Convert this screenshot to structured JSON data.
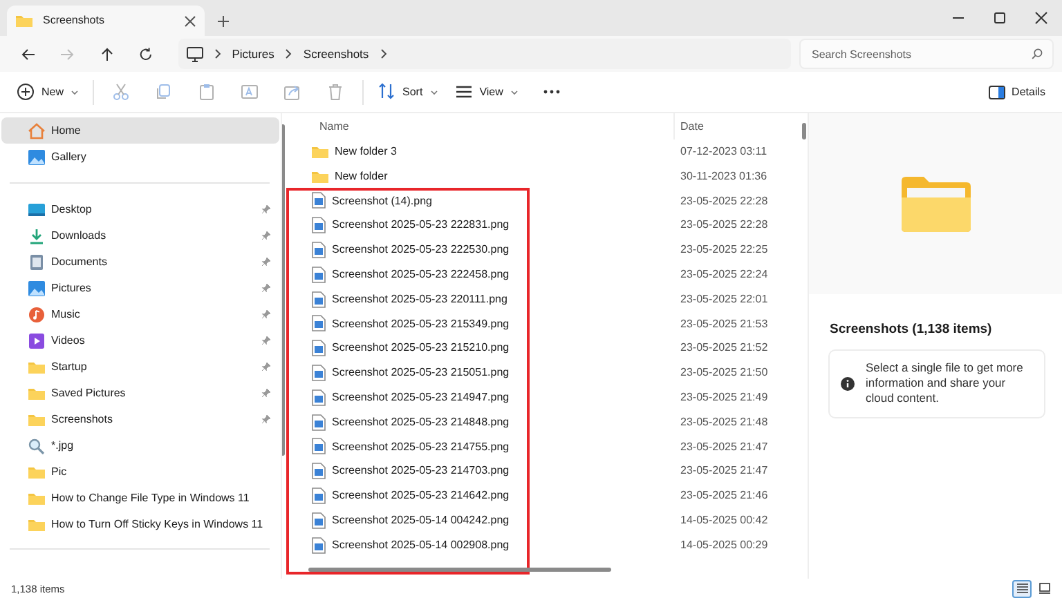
{
  "window": {
    "tab": {
      "title": "Screenshots"
    }
  },
  "navigation": {
    "breadcrumbs": [
      "Pictures",
      "Screenshots"
    ],
    "search": {
      "placeholder": "Search Screenshots"
    }
  },
  "toolbar": {
    "items": [
      {
        "kind": "menu",
        "label": "New",
        "disabled": false
      },
      {
        "kind": "icon",
        "disabled": true
      },
      {
        "kind": "icon",
        "disabled": true
      },
      {
        "kind": "icon",
        "disabled": true
      },
      {
        "kind": "icon",
        "disabled": true
      },
      {
        "kind": "icon",
        "disabled": true
      },
      {
        "kind": "icon",
        "disabled": true
      },
      {
        "kind": "menu",
        "label": "Sort",
        "disabled": false
      },
      {
        "kind": "menu",
        "label": "View",
        "disabled": false
      },
      {
        "kind": "more",
        "disabled": false
      }
    ],
    "details_button": {
      "label": "Details"
    }
  },
  "sidebar": {
    "sections": [
      [
        {
          "label": "Home",
          "pinned": false,
          "selected": true
        },
        {
          "label": "Gallery",
          "pinned": false,
          "selected": false
        }
      ],
      [
        {
          "label": "Desktop",
          "pinned": true,
          "selected": false
        },
        {
          "label": "Downloads",
          "pinned": true,
          "selected": false
        },
        {
          "label": "Documents",
          "pinned": true,
          "selected": false
        },
        {
          "label": "Pictures",
          "pinned": true,
          "selected": false
        },
        {
          "label": "Music",
          "pinned": true,
          "selected": false
        },
        {
          "label": "Videos",
          "pinned": true,
          "selected": false
        },
        {
          "label": "Startup",
          "pinned": true,
          "selected": false
        },
        {
          "label": "Saved Pictures",
          "pinned": true,
          "selected": false
        },
        {
          "label": "Screenshots",
          "pinned": true,
          "selected": false
        },
        {
          "label": "*.jpg",
          "pinned": false,
          "selected": false
        },
        {
          "label": "Pic",
          "pinned": false,
          "selected": false
        },
        {
          "label": "How to Change File Type in Windows 11",
          "pinned": false,
          "selected": false
        },
        {
          "label": "How to Turn Off Sticky Keys in Windows 11",
          "pinned": false,
          "selected": false
        }
      ]
    ]
  },
  "table": {
    "columns": [
      "Name",
      "Date"
    ],
    "rows": [
      {
        "kind": "folder",
        "name": "New folder 3",
        "date": "07-12-2023 03:11"
      },
      {
        "kind": "folder",
        "name": "New folder",
        "date": "30-11-2023 01:36"
      }
    ],
    "highlighted_rows": [
      {
        "kind": "image",
        "name": "Screenshot (14).png",
        "date": "23-05-2025 22:28"
      },
      {
        "kind": "image",
        "name": "Screenshot 2025-05-23 222831.png",
        "date": "23-05-2025 22:28"
      },
      {
        "kind": "image",
        "name": "Screenshot 2025-05-23 222530.png",
        "date": "23-05-2025 22:25"
      },
      {
        "kind": "image",
        "name": "Screenshot 2025-05-23 222458.png",
        "date": "23-05-2025 22:24"
      },
      {
        "kind": "image",
        "name": "Screenshot 2025-05-23 220111.png",
        "date": "23-05-2025 22:01"
      },
      {
        "kind": "image",
        "name": "Screenshot 2025-05-23 215349.png",
        "date": "23-05-2025 21:53"
      },
      {
        "kind": "image",
        "name": "Screenshot 2025-05-23 215210.png",
        "date": "23-05-2025 21:52"
      },
      {
        "kind": "image",
        "name": "Screenshot 2025-05-23 215051.png",
        "date": "23-05-2025 21:50"
      },
      {
        "kind": "image",
        "name": "Screenshot 2025-05-23 214947.png",
        "date": "23-05-2025 21:49"
      },
      {
        "kind": "image",
        "name": "Screenshot 2025-05-23 214848.png",
        "date": "23-05-2025 21:48"
      },
      {
        "kind": "image",
        "name": "Screenshot 2025-05-23 214755.png",
        "date": "23-05-2025 21:47"
      },
      {
        "kind": "image",
        "name": "Screenshot 2025-05-23 214703.png",
        "date": "23-05-2025 21:47"
      },
      {
        "kind": "image",
        "name": "Screenshot 2025-05-23 214642.png",
        "date": "23-05-2025 21:46"
      },
      {
        "kind": "image",
        "name": "Screenshot 2025-05-14 004242.png",
        "date": "14-05-2025 00:42"
      },
      {
        "kind": "image",
        "name": "Screenshot 2025-05-14 002908.png",
        "date": "14-05-2025 00:29"
      }
    ]
  },
  "details": {
    "title": "Screenshots (1,138 items)",
    "info": "Select a single file to get more information and share your cloud content."
  },
  "status_bar": {
    "count": "1,138 items",
    "views": [
      {
        "kind": "details",
        "selected": true
      },
      {
        "kind": "tiles",
        "selected": false
      }
    ]
  }
}
